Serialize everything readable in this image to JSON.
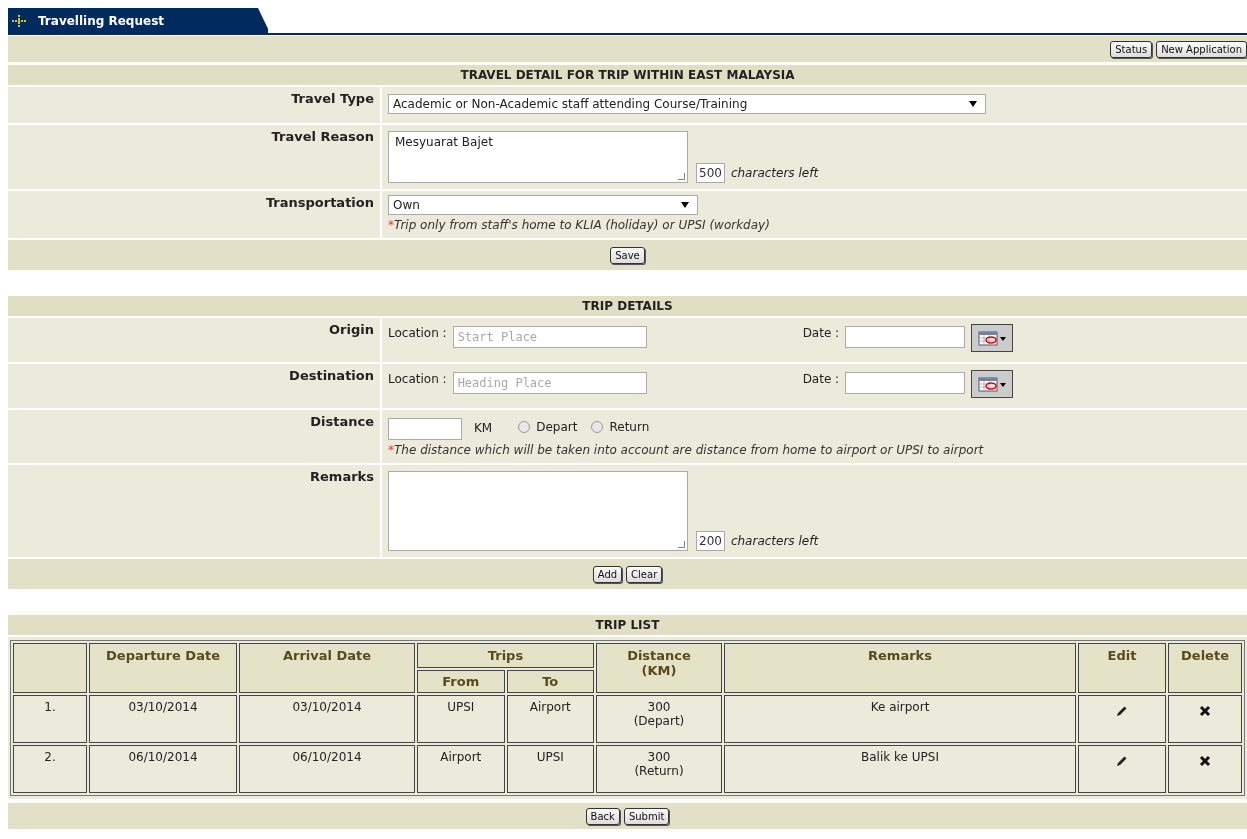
{
  "header_tab": {
    "title": "Travelling Request"
  },
  "toolbar_buttons": [
    "Status",
    "New Application"
  ],
  "travel_detail": {
    "title": "TRAVEL DETAIL FOR TRIP WITHIN EAST MALAYSIA",
    "travel_type": {
      "label": "Travel Type",
      "value": "Academic or Non-Academic staff attending Course/Training"
    },
    "travel_reason": {
      "label": "Travel Reason",
      "value": "Mesyuarat Bajet",
      "counter": "500",
      "counter_suffix": "characters left"
    },
    "transportation": {
      "label": "Transportation",
      "value": "Own",
      "note_mark": "*",
      "note": "Trip only from staff's home to KLIA (holiday) or UPSI (workday)"
    },
    "buttons": [
      "Save"
    ]
  },
  "trip_details": {
    "title": "TRIP DETAILS",
    "legs": [
      {
        "label": "Origin",
        "location_label": "Location :",
        "placeholder": "Start Place",
        "date_label": "Date :"
      },
      {
        "label": "Destination",
        "location_label": "Location :",
        "placeholder": "Heading Place",
        "date_label": "Date :"
      }
    ],
    "distance": {
      "label": "Distance",
      "unit": "KM",
      "options": [
        {
          "label": "Depart",
          "selected": false
        },
        {
          "label": "Return",
          "selected": false
        }
      ],
      "note_mark": "*",
      "note": "The distance which will be taken into account are distance from home to airport or UPSI to airport"
    },
    "remarks": {
      "label": "Remarks",
      "counter": "200",
      "counter_suffix": "characters left"
    },
    "buttons": [
      "Add",
      "Clear"
    ]
  },
  "trip_list": {
    "title": "TRIP LIST",
    "columns": {
      "departure": "Departure Date",
      "arrival": "Arrival Date",
      "trips": "Trips",
      "from": "From",
      "to": "To",
      "distance": "Distance\n(KM)",
      "remarks": "Remarks",
      "edit": "Edit",
      "delete": "Delete"
    },
    "rows": [
      {
        "no": "1.",
        "departure": "03/10/2014",
        "arrival": "03/10/2014",
        "from": "UPSI",
        "to": "Airport",
        "distance": "300\n(Depart)",
        "remarks": "Ke airport"
      },
      {
        "no": "2.",
        "departure": "06/10/2014",
        "arrival": "06/10/2014",
        "from": "Airport",
        "to": "UPSI",
        "distance": "300\n(Return)",
        "remarks": "Balik ke UPSI"
      }
    ],
    "buttons": [
      "Back",
      "Submit"
    ]
  }
}
